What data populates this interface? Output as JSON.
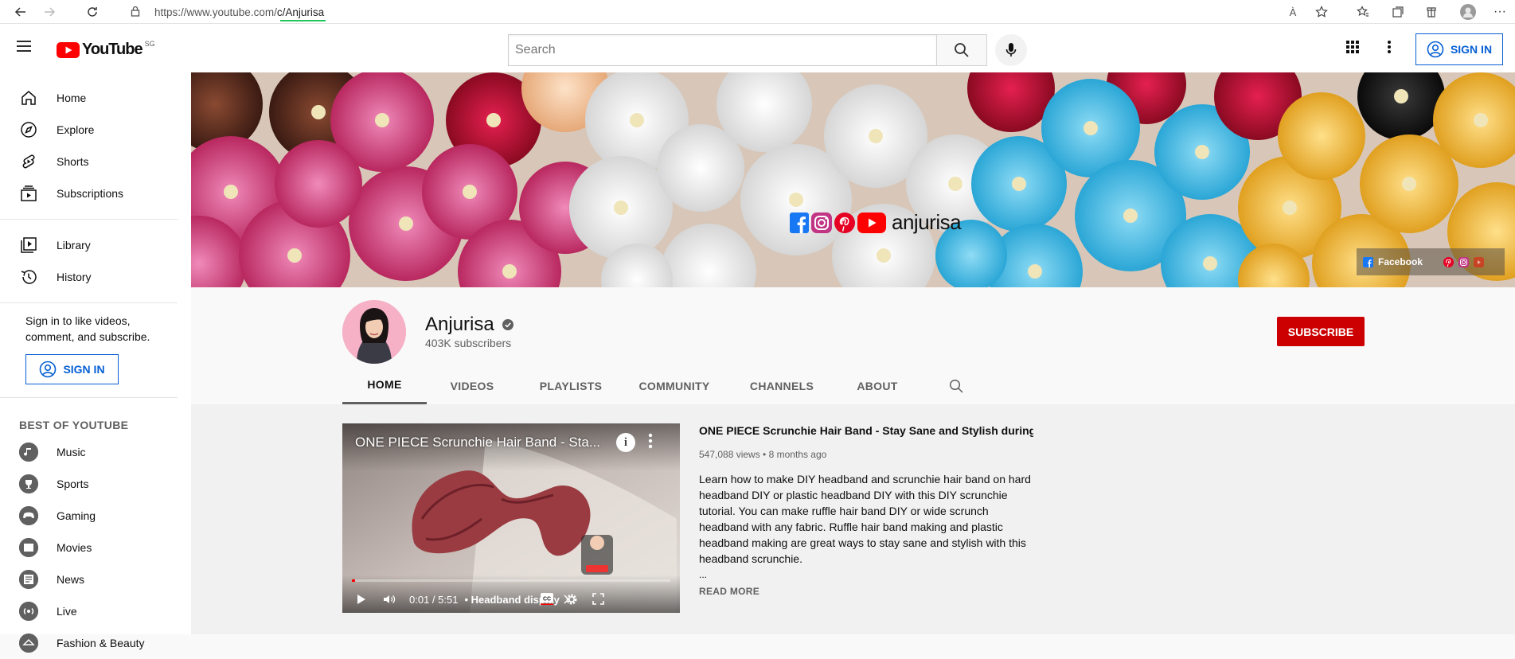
{
  "browser": {
    "url_prefix": "https://www.youtube.com/",
    "url_path": "c/Anjurisa",
    "read_aloud_label": "À"
  },
  "header": {
    "logo_word": "YouTube",
    "region": "SG",
    "search_placeholder": "Search",
    "sign_in": "SIGN IN"
  },
  "sidebar": {
    "items": [
      {
        "label": "Home",
        "icon": "home-icon"
      },
      {
        "label": "Explore",
        "icon": "compass-icon"
      },
      {
        "label": "Shorts",
        "icon": "shorts-icon"
      },
      {
        "label": "Subscriptions",
        "icon": "subscriptions-icon"
      }
    ],
    "items2": [
      {
        "label": "Library",
        "icon": "library-icon"
      },
      {
        "label": "History",
        "icon": "history-icon"
      }
    ],
    "signin_text": "Sign in to like videos, comment, and subscribe.",
    "signin_button": "SIGN IN",
    "best_title": "BEST OF YOUTUBE",
    "best_items": [
      "Music",
      "Sports",
      "Gaming",
      "Movies",
      "News",
      "Live",
      "Fashion & Beauty"
    ]
  },
  "banner": {
    "handle": "anjurisa",
    "social_label": "Facebook"
  },
  "channel": {
    "name": "Anjurisa",
    "subscribers": "403K subscribers",
    "subscribe": "SUBSCRIBE",
    "tabs": [
      "HOME",
      "VIDEOS",
      "PLAYLISTS",
      "COMMUNITY",
      "CHANNELS",
      "ABOUT"
    ],
    "active_tab": "HOME"
  },
  "featured": {
    "player_title": "ONE PIECE Scrunchie Hair Band - Sta...",
    "time": "0:01 / 5:51",
    "chapter": "• Headband display",
    "progress": 0.003,
    "title": "ONE PIECE Scrunchie Hair Band - Stay Sane and Stylish during...",
    "meta": "547,088 views • 8 months ago",
    "description": "Learn how to make DIY headband and scrunchie hair band on hard headband DIY or plastic headband DIY with this DIY scrunchie tutorial. You can make ruffle hair band DIY or wide scrunch headband with any fabric. Ruffle hair band making and plastic headband making are great ways to stay sane and stylish with this headband scrunchie.",
    "ellipsis": "...",
    "read_more": "READ MORE"
  },
  "colors": {
    "brand_red": "#ff0000",
    "subscribe_red": "#cc0000",
    "link_blue": "#065fd4"
  }
}
